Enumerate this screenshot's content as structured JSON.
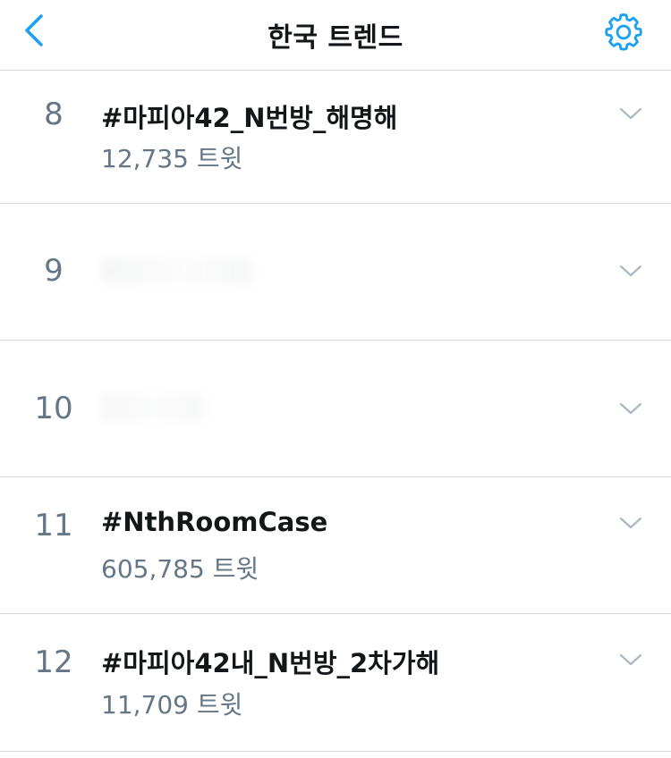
{
  "header": {
    "title": "한국 트렌드",
    "back_icon": "chevron-left-icon",
    "settings_icon": "gear-icon"
  },
  "colors": {
    "accent": "#1da1f2",
    "text_primary": "#14171a",
    "text_secondary": "#657786",
    "divider": "#d6d9dc"
  },
  "trends": [
    {
      "rank": "8",
      "name": "#마피아42_N번방_해명해",
      "count": "12,735 트윗"
    },
    {
      "rank": "9",
      "name": "",
      "count": ""
    },
    {
      "rank": "10",
      "name": "",
      "count": ""
    },
    {
      "rank": "11",
      "name": "#NthRoomCase",
      "count": "605,785 트윗"
    },
    {
      "rank": "12",
      "name": "#마피아42내_N번방_2차가해",
      "count": "11,709 트윗"
    }
  ]
}
